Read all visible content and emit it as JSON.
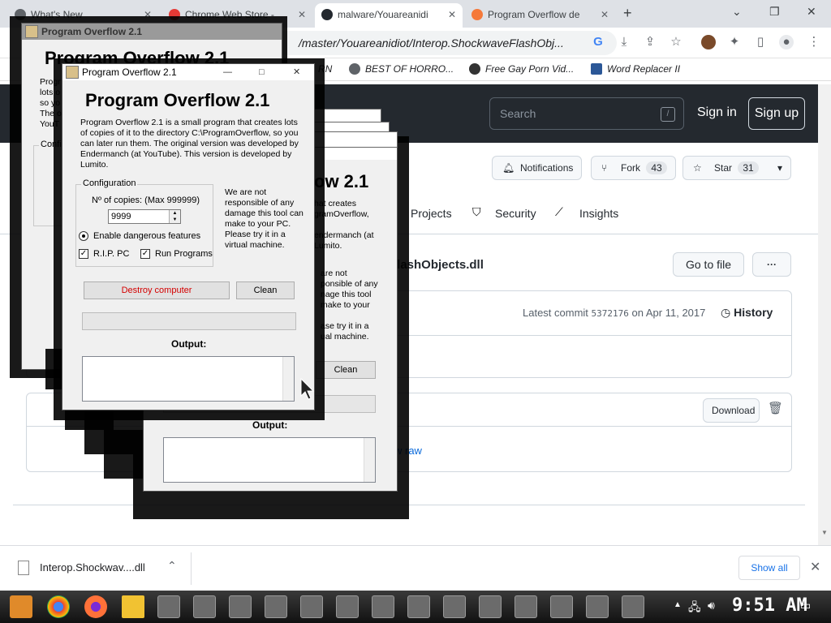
{
  "browser": {
    "tabs": [
      {
        "label": "What's New",
        "active": false
      },
      {
        "label": "Chrome Web Store -",
        "active": false
      },
      {
        "label": "malware/Youareanidi",
        "active": true
      },
      {
        "label": "Program Overflow de",
        "active": false
      }
    ],
    "new_tab": "+",
    "address": "/master/Youareanidiot/Interop.ShockwaveFlashObj...",
    "bookmarks": [
      "RN",
      "BEST OF HORRO...",
      "Free Gay Porn Vid...",
      "Word Replacer II"
    ]
  },
  "github": {
    "search_placeholder": "Search",
    "search_key": "/",
    "sign_in": "Sign in",
    "sign_up": "Sign up",
    "notifications": "Notifications",
    "fork": "Fork",
    "fork_count": "43",
    "star": "Star",
    "star_count": "31",
    "nav": [
      "Projects",
      "Security",
      "Insights"
    ],
    "file_title": "FlashObjects.dll",
    "go_to_file": "Go to file",
    "more": "···",
    "latest_commit": "Latest commit",
    "commit_hash": "5372176",
    "commit_date": "on Apr 11, 2017",
    "history": "History",
    "download": "Download",
    "view_raw": "w raw"
  },
  "dialog": {
    "window_title": "Program Overflow 2.1",
    "heading": "Program Overflow 2.1",
    "description": "Program Overflow 2.1 is a small program that creates lots of copies of it to the directory C:\\ProgramOverflow, so you can later run them. The original version was developed by Endermanch (at YouTube). This version is developed by Lumito.",
    "config_label": "Configuration",
    "copies_label": "Nº of copies: (Max 999999)",
    "copies_value": "9999",
    "dangerous_label": "Enable dangerous features",
    "rip_label": "R.I.P. PC",
    "run_label": "Run Programs",
    "warning": "We are not responsible of any damage this tool can make to your PC. Please try it in a virtual machine.",
    "destroy_label": "Destroy computer",
    "clean_label": "Clean",
    "output_label": "Output:",
    "back_heading": "Program Overflow 2.1",
    "back_desc_partial": "hat creates\ngramOverflow,\n\nendermanch (at\nLumito.",
    "back_warning_partial": "are not\nponsible of any\nnage this tool\nmake to your\n\nase try it in a\nual machine.",
    "back_heading_partial": "ow 2.1",
    "far_heading_partial": "Program Overflow 2.1",
    "far_left_partial": [
      "Progr",
      "lots o",
      "so yo",
      "The o",
      "YouT",
      "Config"
    ]
  },
  "downloads": {
    "file": "Interop.Shockwav....dll",
    "show_all": "Show all"
  },
  "taskbar": {
    "clock": "9:51 AM"
  },
  "colors": {
    "github_header": "#24292f",
    "destroy_text": "#d40000"
  }
}
